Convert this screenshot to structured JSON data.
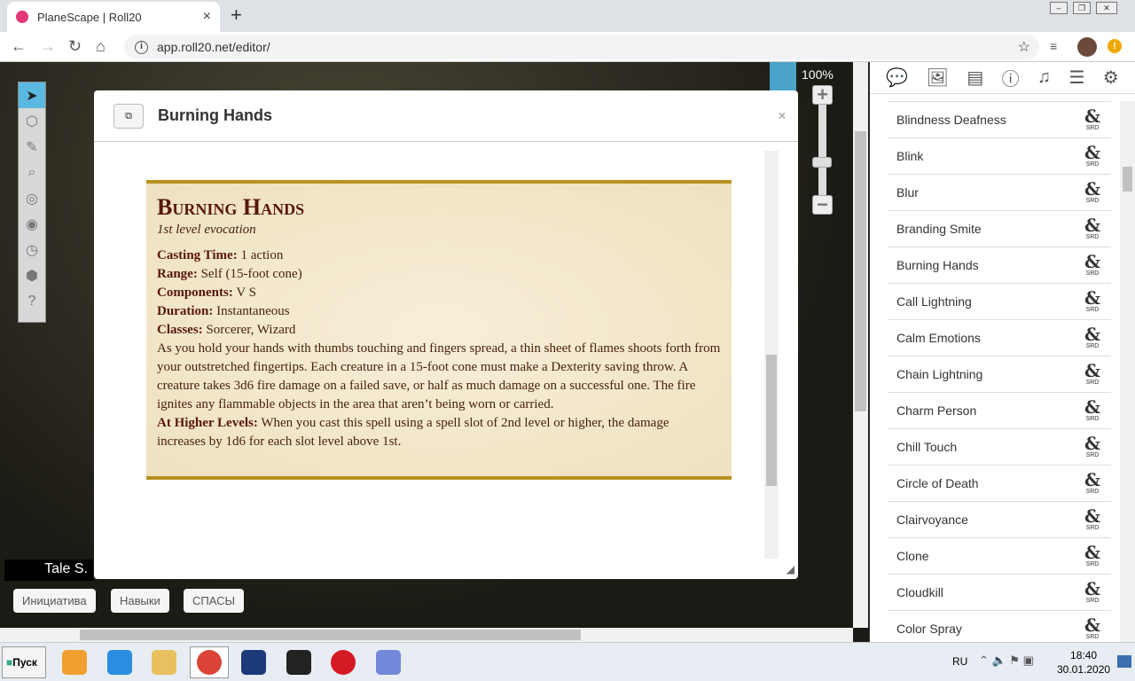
{
  "browser": {
    "tab_title": "PlaneScape | Roll20",
    "url": "app.roll20.net/editor/",
    "new_tab": "+",
    "close": "×"
  },
  "canvas": {
    "zoom": "100%",
    "zoom_in": "+",
    "zoom_out": "−",
    "player_name": "Tale S.",
    "tools": [
      "select-icon",
      "cube-icon",
      "brush-icon",
      "magnifier-icon",
      "compass-icon",
      "eye-icon",
      "clock-icon",
      "d20-icon",
      "help-icon"
    ],
    "macros": [
      "Инициатива",
      "Навыки",
      "СПАСЫ"
    ]
  },
  "modal": {
    "title": "Burning Hands",
    "close": "×",
    "spell": {
      "name": "Burning Hands",
      "type": "1st level evocation",
      "fields": [
        {
          "label": "Casting Time:",
          "value": " 1 action"
        },
        {
          "label": "Range:",
          "value": " Self (15-foot cone)"
        },
        {
          "label": "Components:",
          "value": " V S"
        },
        {
          "label": "Duration:",
          "value": " Instantaneous"
        },
        {
          "label": "Classes:",
          "value": " Sorcerer, Wizard"
        }
      ],
      "description": "As you hold your hands with thumbs touching and fingers spread, a thin sheet of flames shoots forth from your outstretched fingertips. Each creature in a 15-foot cone must make a Dexterity saving throw. A creature takes 3d6 fire damage on a failed save, or half as much damage on a successful one. The fire ignites any flammable objects in the area that aren’t being worn or carried.",
      "higher_label": "At Higher Levels:",
      "higher_text": " When you cast this spell using a spell slot of 2nd level or higher, the damage increases by 1d6 for each slot level above 1st."
    }
  },
  "sidebar": {
    "tabs": [
      "chat-icon",
      "art-icon",
      "journal-icon",
      "info-icon",
      "jukebox-icon",
      "list-icon",
      "settings-icon"
    ],
    "badge_amp": "&",
    "badge_srd": "SRD",
    "items": [
      "Blindness Deafness",
      "Blink",
      "Blur",
      "Branding Smite",
      "Burning Hands",
      "Call Lightning",
      "Calm Emotions",
      "Chain Lightning",
      "Charm Person",
      "Chill Touch",
      "Circle of Death",
      "Clairvoyance",
      "Clone",
      "Cloudkill",
      "Color Spray"
    ]
  },
  "taskbar": {
    "start": "Пуск",
    "lang": "RU",
    "time": "18:40",
    "date": "30.01.2020",
    "apps": [
      {
        "name": "media-player",
        "color": "#f0a030"
      },
      {
        "name": "internet-explorer",
        "color": "#2a8de0"
      },
      {
        "name": "explorer",
        "color": "#e8c060"
      },
      {
        "name": "chrome",
        "color": "#db4437"
      },
      {
        "name": "photoshop",
        "color": "#1c3a7a"
      },
      {
        "name": "nox",
        "color": "#222222"
      },
      {
        "name": "opera",
        "color": "#d51a25"
      },
      {
        "name": "discord",
        "color": "#7289da"
      }
    ]
  }
}
